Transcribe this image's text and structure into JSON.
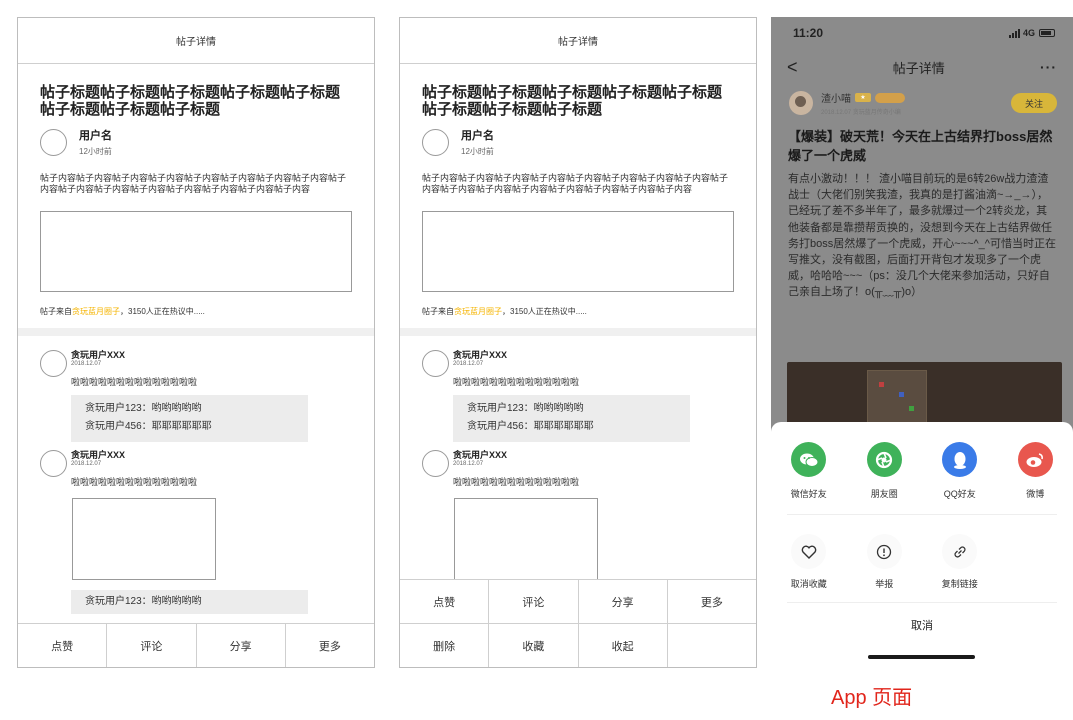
{
  "wireframe": {
    "nav_title": "帖子详情",
    "post_title": "帖子标题帖子标题帖子标题帖子标题帖子标题帖子标题帖子标题帖子标题",
    "author_name": "用户名",
    "author_time": "12小时前",
    "content": "帖子内容帖子内容帖子内容帖子内容帖子内容帖子内容帖子内容帖子内容帖子内容帖子内容帖子内容帖子内容帖子内容帖子内容帖子内容帖子内容",
    "source_prefix": "帖子来自",
    "source_circle": "贪玩蓝月圈子",
    "source_suffix": "，3150人正在热议中.....",
    "comments": [
      {
        "name": "贪玩用户XXX",
        "date": "2018.12.07",
        "text": "啦啦啦啦啦啦啦啦啦啦啦啦啦啦",
        "replies": [
          "贪玩用户123：哟哟哟哟哟",
          "贪玩用户456：耶耶耶耶耶耶"
        ]
      },
      {
        "name": "贪玩用户XXX",
        "date": "2018.12.07",
        "text": "啦啦啦啦啦啦啦啦啦啦啦啦啦啦",
        "replies": [
          "贪玩用户123：哟哟哟哟哟"
        ]
      }
    ],
    "bar_primary": [
      "点赞",
      "评论",
      "分享",
      "更多"
    ],
    "bar_secondary": [
      "删除",
      "收藏",
      "收起",
      ""
    ]
  },
  "app": {
    "status_time": "11:20",
    "status_network": "4G",
    "nav_title": "帖子详情",
    "nav_back": "<",
    "nav_more": "···",
    "author_name": "渣小喵",
    "author_meta": "2018.12.07  贪玩蓝月传奇小编",
    "follow_label": "关注",
    "post_title": "【爆装】破天荒！今天在上古结界打boss居然爆了一个虎威",
    "post_body": "有点小激动！！！ 渣小喵目前玩的是6转26w战力渣渣战士（大佬们别笑我渣，我真的是打酱油滴~→_→），已经玩了差不多半年了，最多就爆过一个2转炎龙，其他装备都是靠攒帮贡换的，没想到今天在上古结界做任务打boss居然爆了一个虎威，开心~~~^_^可惜当时正在写推文，没有截图，后面打开背包才发现多了一个虎威，哈哈哈~~~（ps：没几个大佬来参加活动，只好自己亲自上场了！o(╥﹏╥)o）",
    "share_items": [
      {
        "label": "微信好友",
        "icon": "wechat-icon",
        "color": "#3fb25a"
      },
      {
        "label": "朋友圈",
        "icon": "moments-icon",
        "color": "#3fb25a"
      },
      {
        "label": "QQ好友",
        "icon": "qq-icon",
        "color": "#3a7be8"
      },
      {
        "label": "微博",
        "icon": "weibo-icon",
        "color": "#e8574e"
      }
    ],
    "action_items": [
      {
        "label": "取消收藏",
        "icon": "heart-icon"
      },
      {
        "label": "举报",
        "icon": "report-icon"
      },
      {
        "label": "复制链接",
        "icon": "link-icon"
      }
    ],
    "cancel_label": "取消"
  },
  "caption": "App 页面",
  "colors": {
    "highlight": "#f5b400",
    "follow": "#d8b63a",
    "caption": "#e1251b"
  }
}
